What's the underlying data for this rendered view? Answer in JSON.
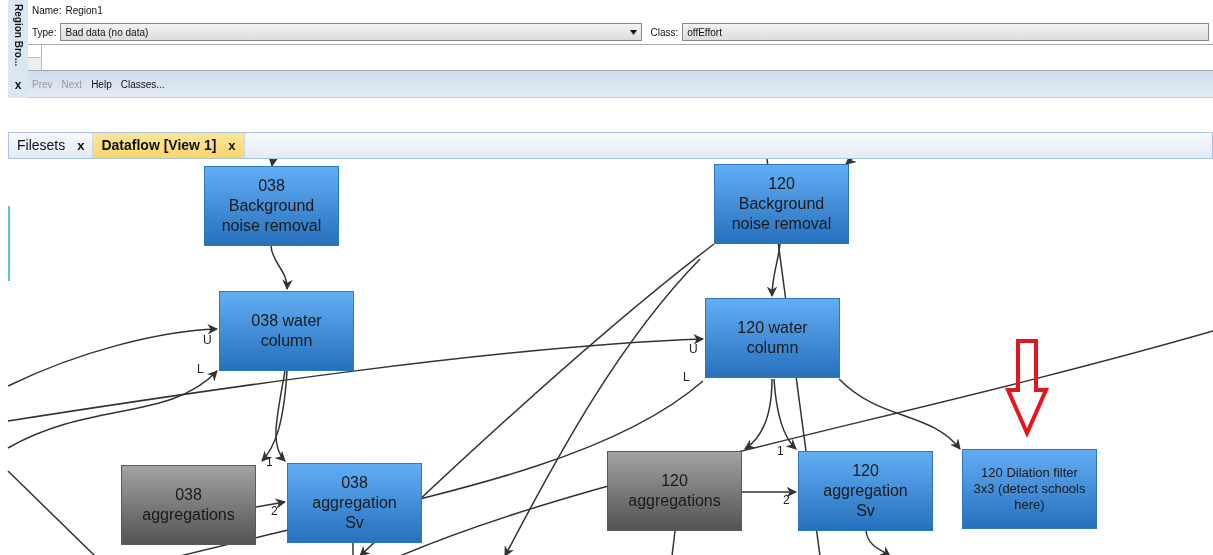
{
  "side_panel": {
    "title": "Region Bro...",
    "close": "x"
  },
  "form": {
    "name_label": "Name:",
    "name_value": "Region1",
    "type_label": "Type:",
    "type_value": "Bad data (no data)",
    "class_label": "Class:",
    "class_value": "offEffort"
  },
  "toolbar": [
    {
      "label": "Prev",
      "disabled": true
    },
    {
      "label": "Next",
      "disabled": true
    },
    {
      "label": "Help",
      "disabled": false
    },
    {
      "label": "Classes...",
      "disabled": false
    }
  ],
  "tabs": [
    {
      "label": "Filesets",
      "close": "x",
      "selected": false
    },
    {
      "label": "Dataflow [View 1]",
      "close": "x",
      "selected": true
    }
  ],
  "nodes": [
    {
      "text": "038 Background noise removal",
      "kind": "module"
    },
    {
      "text": "038 water column",
      "kind": "module"
    },
    {
      "text": "038 aggregations",
      "kind": "data"
    },
    {
      "text": "038 aggregation Sv",
      "kind": "module"
    },
    {
      "text": "120 Background noise removal",
      "kind": "module"
    },
    {
      "text": "120 water column",
      "kind": "module"
    },
    {
      "text": "120 aggregations",
      "kind": "data"
    },
    {
      "text": "120 aggregation Sv",
      "kind": "module"
    },
    {
      "text": "120 Dilation filter 3x3 (detect schools here)",
      "kind": "module"
    }
  ],
  "port_labels": [
    "U",
    "L",
    "1",
    "2",
    "U",
    "L",
    "1",
    "2"
  ]
}
